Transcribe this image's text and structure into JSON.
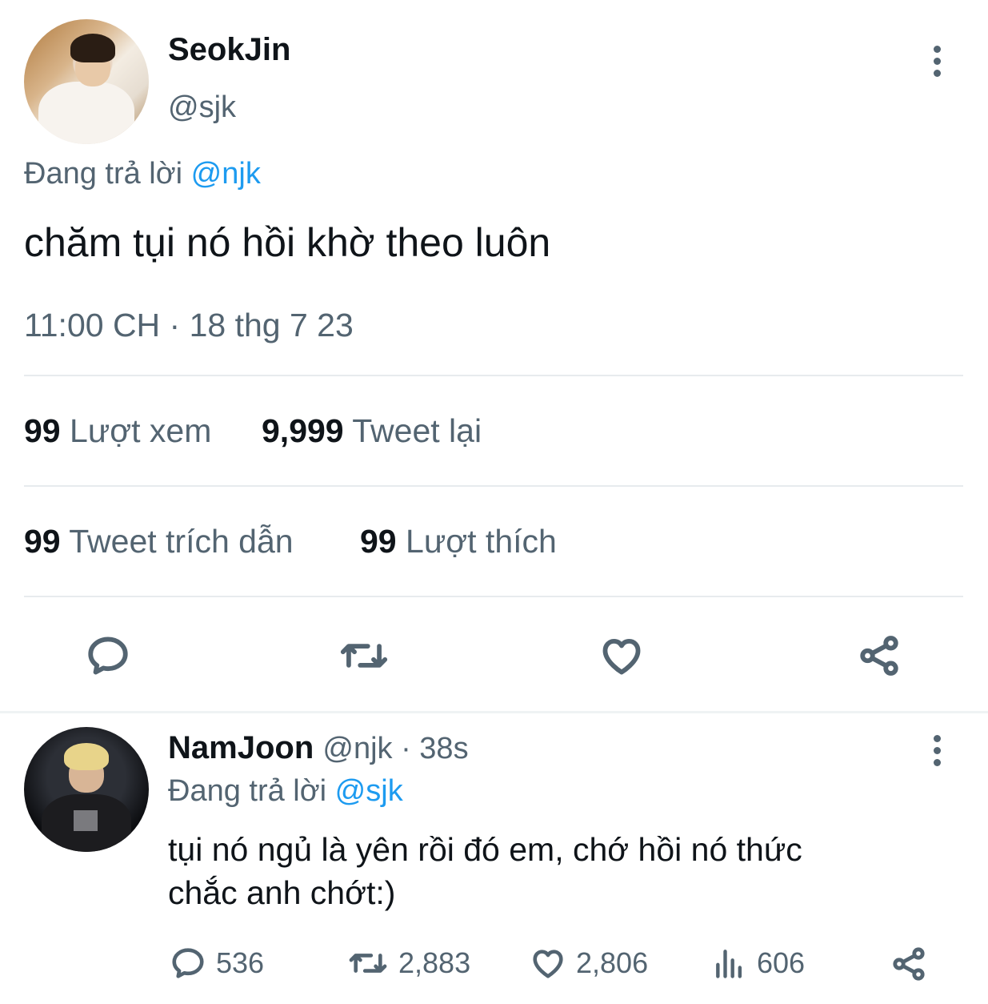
{
  "main_tweet": {
    "display_name": "SeokJin",
    "handle": "@sjk",
    "replying_prefix": "Đang trả lời ",
    "replying_to": "@njk",
    "text": "chăm tụi nó hồi khờ theo luôn",
    "timestamp": "11:00 CH · 18 thg 7 23",
    "stats": {
      "views_count": "99",
      "views_label": "Lượt xem",
      "retweets_count": "9,999",
      "retweets_label": "Tweet lại",
      "quotes_count": "99",
      "quotes_label": "Tweet trích dẫn",
      "likes_count": "99",
      "likes_label": "Lượt thích"
    },
    "actions": [
      "reply-icon",
      "retweet-icon",
      "heart-icon",
      "share-icon"
    ]
  },
  "reply_tweet": {
    "display_name": "NamJoon",
    "handle": "@njk",
    "time": " · 38s",
    "replying_prefix": "Đang trả lời ",
    "replying_to": "@sjk",
    "text_line1": "tụi nó ngủ là yên rồi đó em,  chớ hồi nó thức",
    "text_line2": "chắc anh chớt:)",
    "counts": {
      "replies": "536",
      "retweets": "2,883",
      "likes": "2,806",
      "views": "606"
    }
  },
  "colors": {
    "accent": "#1d9bf0",
    "secondary_text": "#536471",
    "primary_text": "#0f1419",
    "divider": "#e7ebee"
  }
}
